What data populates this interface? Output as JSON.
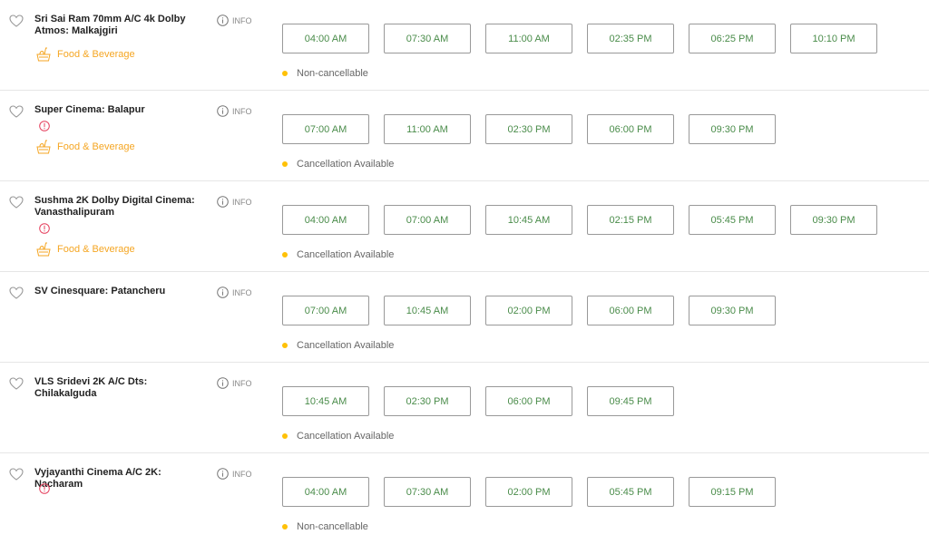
{
  "info_label": "INFO",
  "colors": {
    "showtime_text": "#4a8c4a",
    "food_beverage": "#f5a623",
    "status_dot": "#ffc107",
    "alert": "#e5405e"
  },
  "venues": [
    {
      "name": "Sri Sai Ram 70mm A/C 4k Dolby Atmos: Malkajgiri",
      "has_alert_icon": false,
      "food_beverage": "Food & Beverage",
      "showtimes": [
        "04:00 AM",
        "07:30 AM",
        "11:00 AM",
        "02:35 PM",
        "06:25 PM",
        "10:10 PM"
      ],
      "status": "Non-cancellable"
    },
    {
      "name": "Super Cinema: Balapur",
      "has_alert_icon": true,
      "food_beverage": "Food & Beverage",
      "showtimes": [
        "07:00 AM",
        "11:00 AM",
        "02:30 PM",
        "06:00 PM",
        "09:30 PM"
      ],
      "status": "Cancellation Available"
    },
    {
      "name": "Sushma 2K Dolby Digital Cinema: Vanasthalipuram",
      "has_alert_icon": true,
      "food_beverage": "Food & Beverage",
      "showtimes": [
        "04:00 AM",
        "07:00 AM",
        "10:45 AM",
        "02:15 PM",
        "05:45 PM",
        "09:30 PM"
      ],
      "status": "Cancellation Available"
    },
    {
      "name": "SV Cinesquare: Patancheru",
      "has_alert_icon": false,
      "food_beverage": null,
      "showtimes": [
        "07:00 AM",
        "10:45 AM",
        "02:00 PM",
        "06:00 PM",
        "09:30 PM"
      ],
      "status": "Cancellation Available"
    },
    {
      "name": "VLS Sridevi 2K A/C Dts: Chilakalguda",
      "has_alert_icon": false,
      "food_beverage": null,
      "showtimes": [
        "10:45 AM",
        "02:30 PM",
        "06:00 PM",
        "09:45 PM"
      ],
      "status": "Cancellation Available"
    },
    {
      "name": "Vyjayanthi Cinema A/C 2K: Nacharam",
      "has_alert_icon": true,
      "food_beverage": null,
      "showtimes": [
        "04:00 AM",
        "07:30 AM",
        "02:00 PM",
        "05:45 PM",
        "09:15 PM"
      ],
      "status": "Non-cancellable"
    }
  ]
}
